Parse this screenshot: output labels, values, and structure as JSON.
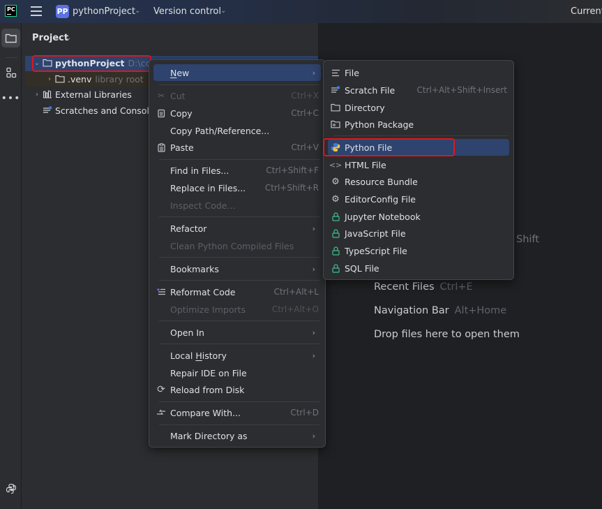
{
  "titlebar": {
    "app_logo": "PC",
    "project_badge": "PP",
    "project_name": "pythonProject",
    "version_control": "Version control",
    "current_label": "Current"
  },
  "project_panel": {
    "title": "Project",
    "tree": [
      {
        "label": "pythonProject",
        "hint": "D:\\cod",
        "expanded": true,
        "icon": "folder-icon"
      },
      {
        "label": ".venv",
        "hint": "library root",
        "expanded": false,
        "icon": "folder-icon"
      },
      {
        "label": "External Libraries",
        "hint": "",
        "expanded": false,
        "icon": "library-icon"
      },
      {
        "label": "Scratches and Consol",
        "hint": "",
        "icon": "scratches-icon"
      }
    ]
  },
  "context_menu": {
    "items": [
      {
        "label": "New",
        "mnemonic": "N",
        "submenu": true,
        "highlighted": true
      },
      {
        "label": "Cut",
        "shortcut": "Ctrl+X",
        "disabled": true,
        "icon": "scissors-icon"
      },
      {
        "label": "Copy",
        "shortcut": "Ctrl+C",
        "icon": "copy-icon"
      },
      {
        "label": "Copy Path/Reference..."
      },
      {
        "label": "Paste",
        "shortcut": "Ctrl+V",
        "icon": "paste-icon"
      },
      {
        "label": "Find in Files...",
        "shortcut": "Ctrl+Shift+F"
      },
      {
        "label": "Replace in Files...",
        "shortcut": "Ctrl+Shift+R"
      },
      {
        "label": "Inspect Code...",
        "disabled": true
      },
      {
        "label": "Refactor",
        "submenu": true
      },
      {
        "label": "Clean Python Compiled Files",
        "disabled": true
      },
      {
        "label": "Bookmarks",
        "submenu": true
      },
      {
        "label": "Reformat Code",
        "shortcut": "Ctrl+Alt+L",
        "icon": "reformat-icon"
      },
      {
        "label": "Optimize Imports",
        "shortcut": "Ctrl+Alt+O",
        "disabled": true
      },
      {
        "label": "Open In",
        "submenu": true
      },
      {
        "label": "Local History",
        "submenu": true
      },
      {
        "label": "Repair IDE on File"
      },
      {
        "label": "Reload from Disk",
        "icon": "reload-icon"
      },
      {
        "label": "Compare With...",
        "shortcut": "Ctrl+D",
        "icon": "compare-icon"
      },
      {
        "label": "Mark Directory as",
        "submenu": true
      }
    ]
  },
  "new_submenu": {
    "items": [
      {
        "label": "File",
        "icon": "file-icon"
      },
      {
        "label": "Scratch File",
        "shortcut": "Ctrl+Alt+Shift+Insert",
        "icon": "scratch-file-icon"
      },
      {
        "label": "Directory",
        "icon": "directory-icon"
      },
      {
        "label": "Python Package",
        "icon": "python-package-icon"
      },
      {
        "label": "Python File",
        "icon": "python-icon",
        "highlighted": true
      },
      {
        "label": "HTML File",
        "icon": "html-icon"
      },
      {
        "label": "Resource Bundle",
        "icon": "gear-icon"
      },
      {
        "label": "EditorConfig File",
        "icon": "gear-icon"
      },
      {
        "label": "Jupyter Notebook",
        "icon": "lock-icon"
      },
      {
        "label": "JavaScript File",
        "icon": "lock-icon"
      },
      {
        "label": "TypeScript File",
        "icon": "lock-icon"
      },
      {
        "label": "SQL File",
        "icon": "lock-icon"
      }
    ]
  },
  "editor_empty": {
    "partial_shortcut": "Shift",
    "hints": [
      {
        "label": "Recent Files",
        "shortcut": "Ctrl+E"
      },
      {
        "label": "Navigation Bar",
        "shortcut": "Alt+Home"
      },
      {
        "label": "Drop files here to open them",
        "shortcut": ""
      }
    ]
  },
  "colors": {
    "accent_selection": "#2e436e",
    "highlight_box": "#e0161c",
    "lock_icon": "#3fbf8a"
  }
}
